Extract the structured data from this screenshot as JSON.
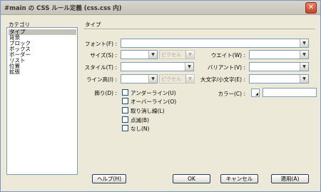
{
  "window": {
    "title": "#main の CSS ルール定義 (css.css 内)"
  },
  "categories": {
    "heading": "カテゴリ",
    "items": [
      "タイプ",
      "背景",
      "ブロック",
      "ボックス",
      "ボーダー",
      "リスト",
      "位置",
      "拡張"
    ],
    "selected": "タイプ"
  },
  "panel": {
    "heading": "タイプ",
    "font_label": "フォント(F) :",
    "size_label": "サイズ(S) :",
    "size_unit": "ピクセル",
    "weight_label": "ウエイト(W) :",
    "style_label": "スタイル(T) :",
    "variant_label": "バリアント(V) :",
    "line_height_label": "ライン高(I) :",
    "line_height_unit": "ピクセル",
    "case_label": "大文字/小文字(E) :",
    "decoration_label": "飾り(D) :",
    "decorations": [
      "アンダーライン(U)",
      "オーバーライン(O)",
      "取り消し線(L)",
      "点滅(B)",
      "なし(N)"
    ],
    "color_label": "カラー(C) :"
  },
  "buttons": {
    "help": "ヘルプ(H)",
    "ok": "OK",
    "cancel": "キャンセル",
    "apply": "適用(A)"
  }
}
